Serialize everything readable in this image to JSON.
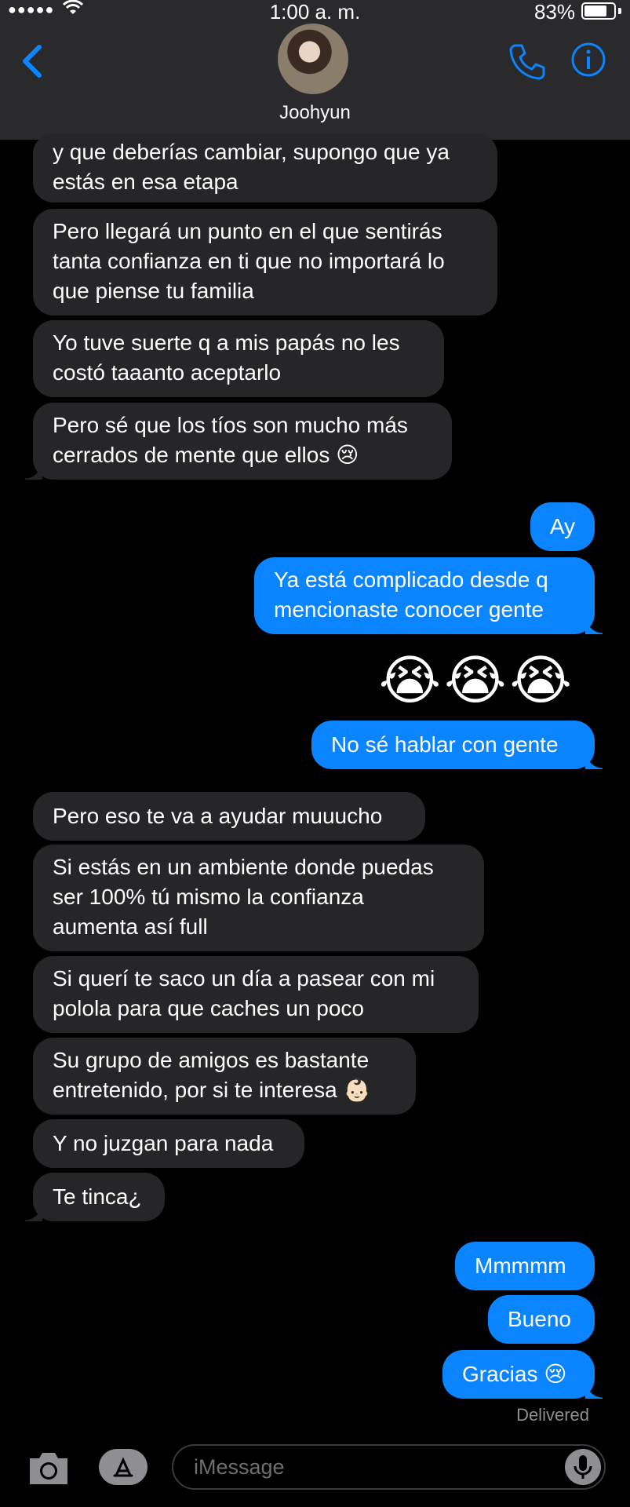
{
  "status_bar": {
    "signal": "●●●●●",
    "time": "1:00 a. m.",
    "battery_percent": "83%",
    "battery_level": 0.83
  },
  "header": {
    "contact_name": "Joohyun",
    "back_icon": "chevron-left-icon",
    "call_icon": "phone-icon",
    "info_icon": "info-icon"
  },
  "messages": [
    {
      "direction": "incoming",
      "text": "y que deberías cambiar, supongo que ya\nestás en esa etapa"
    },
    {
      "direction": "incoming",
      "text": "Pero llegará un punto en el que sentirás\ntanta confianza en ti que no importará lo\nque piense tu familia"
    },
    {
      "direction": "incoming",
      "text": "Yo tuve suerte q a mis papás no les\ncostó taaanto aceptarlo"
    },
    {
      "direction": "incoming",
      "text": "Pero sé que los tíos son mucho más\ncerrados de mente que ellos 😢"
    },
    {
      "direction": "outgoing",
      "text": "Ay"
    },
    {
      "direction": "outgoing",
      "text": "Ya está complicado desde q\nmencionaste conocer gente"
    },
    {
      "direction": "outgoing",
      "text": "😭😭😭"
    },
    {
      "direction": "outgoing",
      "text": "No sé hablar con gente"
    },
    {
      "direction": "incoming",
      "text": "Pero eso te va a ayudar muuucho"
    },
    {
      "direction": "incoming",
      "text": "Si estás en un ambiente donde puedas\nser 100% tú mismo la confianza\naumenta así full"
    },
    {
      "direction": "incoming",
      "text": "Si querí te saco un día a pasear con mi\npolola para que caches un poco"
    },
    {
      "direction": "incoming",
      "text": "Su grupo de amigos es bastante\nentretenido, por si te interesa 👶🏻"
    },
    {
      "direction": "incoming",
      "text": "Y no juzgan para nada"
    },
    {
      "direction": "incoming",
      "text": "Te tinca¿"
    },
    {
      "direction": "outgoing",
      "text": "Mmmmm"
    },
    {
      "direction": "outgoing",
      "text": "Bueno"
    },
    {
      "direction": "outgoing",
      "text": "Gracias 😢"
    }
  ],
  "delivery_status": "Delivered",
  "input_bar": {
    "camera_icon": "camera-icon",
    "apps_icon": "app-store-icon",
    "placeholder": "iMessage",
    "mic_icon": "microphone-icon"
  },
  "colors": {
    "background": "#000000",
    "header": "#2a2a2c",
    "incoming_bubble": "#262628",
    "outgoing_bubble": "#0a84ff",
    "accent": "#0a84ff"
  }
}
